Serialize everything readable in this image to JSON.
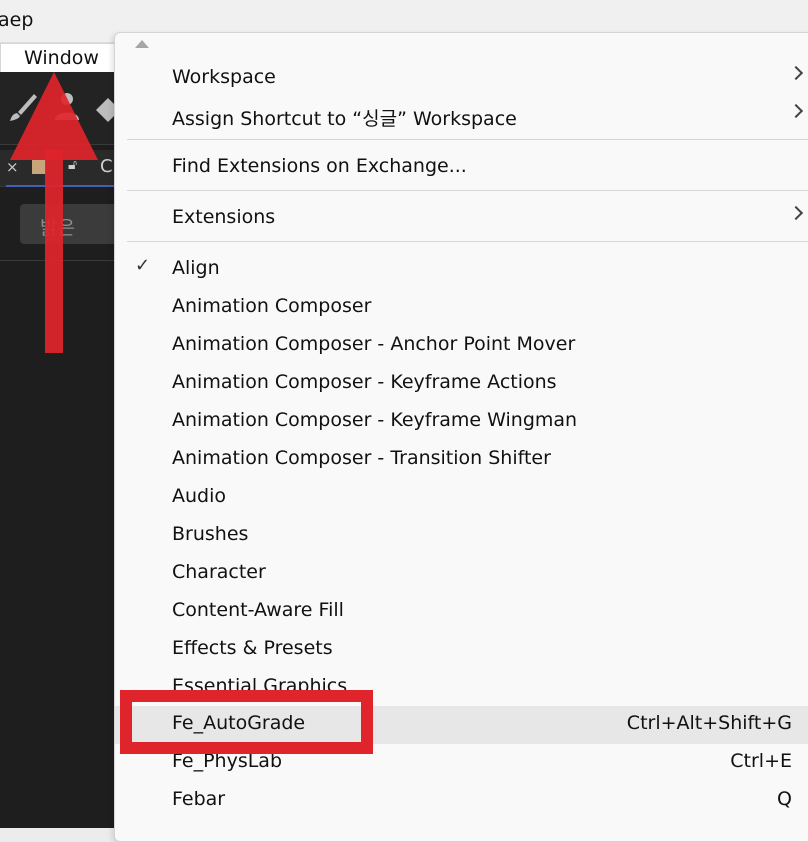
{
  "titlebar": {
    "title": "aep"
  },
  "menubar": {
    "window_label": "Window"
  },
  "panel": {
    "tab_partial": "C",
    "button_label": "밝은"
  },
  "menu": {
    "items": [
      {
        "label": "Workspace",
        "submenu": true
      },
      {
        "label": "Assign Shortcut to “싱글” Workspace",
        "submenu": true
      },
      {
        "label": "Find Extensions on Exchange..."
      },
      {
        "label": "Extensions",
        "submenu": true
      },
      {
        "label": "Align",
        "checked": true
      },
      {
        "label": "Animation Composer"
      },
      {
        "label": "Animation Composer - Anchor Point Mover"
      },
      {
        "label": "Animation Composer - Keyframe Actions"
      },
      {
        "label": "Animation Composer - Keyframe Wingman"
      },
      {
        "label": "Animation Composer - Transition Shifter"
      },
      {
        "label": "Audio"
      },
      {
        "label": "Brushes"
      },
      {
        "label": "Character"
      },
      {
        "label": "Content-Aware Fill"
      },
      {
        "label": "Effects & Presets"
      },
      {
        "label": "Essential Graphics"
      },
      {
        "label": "Fe_AutoGrade",
        "shortcut": "Ctrl+Alt+Shift+G",
        "highlighted": true
      },
      {
        "label": "Fe_PhysLab",
        "shortcut": "Ctrl+E"
      },
      {
        "label": "Febar",
        "shortcut": "Q"
      }
    ]
  },
  "colors": {
    "annotation_red": "#e0242b",
    "menu_bg": "#f9f9f9",
    "app_bg": "#1e1e1e"
  },
  "icons": [
    "brush-icon",
    "puppet-icon",
    "eraser-icon",
    "close-icon",
    "lock-icon",
    "checkmark-icon",
    "chevron-right-icon",
    "scroll-up-icon"
  ]
}
